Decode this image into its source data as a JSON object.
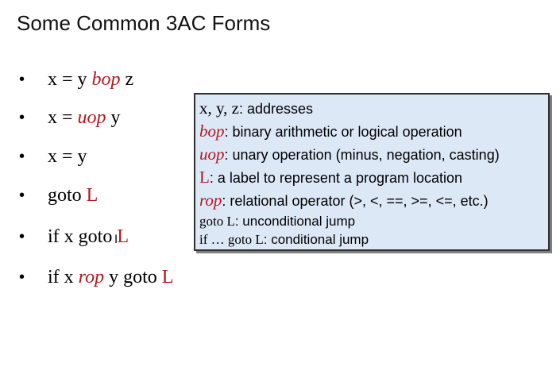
{
  "slide": {
    "title": "Some Common 3AC Forms"
  },
  "bullets": [
    {
      "marker": "•",
      "parts": [
        {
          "text": "x = y ",
          "style": "normal"
        },
        {
          "text": "bop",
          "style": "red-italic"
        },
        {
          "text": " z",
          "style": "normal"
        }
      ]
    },
    {
      "marker": "•",
      "parts": [
        {
          "text": "x = ",
          "style": "normal"
        },
        {
          "text": "uop",
          "style": "red-italic"
        },
        {
          "text": " y",
          "style": "normal"
        }
      ]
    },
    {
      "marker": "•",
      "parts": [
        {
          "text": "x = y",
          "style": "normal"
        }
      ]
    },
    {
      "marker": "•",
      "parts": [
        {
          "text": "goto ",
          "style": "normal"
        },
        {
          "text": "L",
          "style": "red"
        }
      ]
    },
    {
      "marker": "•",
      "parts": [
        {
          "text": "if x goto ",
          "style": "normal"
        },
        {
          "text": "L",
          "style": "red"
        }
      ]
    },
    {
      "marker": "•",
      "parts": [
        {
          "text": "if x ",
          "style": "normal"
        },
        {
          "text": "rop",
          "style": "red-italic"
        },
        {
          "text": " y goto ",
          "style": "normal"
        },
        {
          "text": "L",
          "style": "red"
        }
      ]
    }
  ],
  "legend": {
    "lines": [
      {
        "term": "x, y, z",
        "term_style": "serif",
        "desc": ": addresses"
      },
      {
        "term": "bop",
        "term_style": "red-italic-serif",
        "desc": ": binary arithmetic or logical operation"
      },
      {
        "term": "uop",
        "term_style": "red-italic-serif",
        "desc": ": unary operation (minus, negation, casting)"
      },
      {
        "term": "L",
        "term_style": "red-serif-large",
        "desc": ": a label to represent a program location"
      },
      {
        "term": "rop",
        "term_style": "red-italic-serif",
        "desc": ": relational operator (>, <, ==, >=, <=, etc.)"
      },
      {
        "term": "goto L",
        "term_style": "serif-small",
        "desc": ": unconditional jump"
      },
      {
        "term": "if … goto L",
        "term_style": "serif-small",
        "desc": ": conditional jump"
      }
    ]
  },
  "colors": {
    "accent_red": "#b3161c",
    "legend_background": "#dde8f7",
    "legend_border": "#2f2f2f"
  },
  "icons": {
    "cursor": "text-cursor-icon"
  }
}
